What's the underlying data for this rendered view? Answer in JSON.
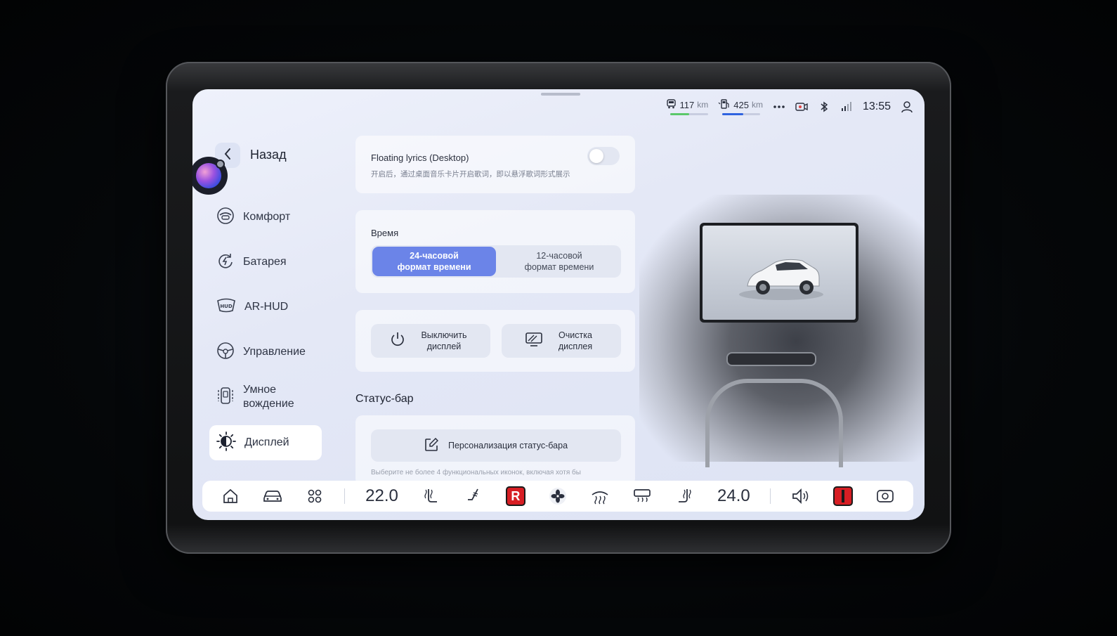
{
  "status_bar": {
    "range1_value": "117",
    "range1_unit": "km",
    "range1_level": 0.5,
    "range2_value": "425",
    "range2_unit": "km",
    "range2_level": 0.55,
    "time": "13:55",
    "colors": {
      "range1": "#5bc86a",
      "range2": "#2f63e0"
    }
  },
  "nav": {
    "back_label": "Назад",
    "items": [
      {
        "label": "Комфорт",
        "icon": "steering-comfort-icon"
      },
      {
        "label": "Батарея",
        "icon": "battery-cycle-icon"
      },
      {
        "label": "AR-HUD",
        "icon": "hud-icon"
      },
      {
        "label": "Управление",
        "icon": "steering-wheel-icon"
      },
      {
        "label": "Умное вождение",
        "icon": "smart-driving-icon"
      },
      {
        "label": "Дисплей",
        "icon": "brightness-icon",
        "active": true
      }
    ]
  },
  "settings": {
    "floating_lyrics": {
      "title": "Floating lyrics (Desktop)",
      "subtitle": "开启后，通过桌面音乐卡片开启歌词，即以悬浮歌词形式展示",
      "enabled": false
    },
    "time": {
      "title": "Время",
      "option_24": "24-часовой формат времени",
      "option_12": "12-часовой формат времени",
      "selected": "24"
    },
    "actions": {
      "turn_off_display": "Выключить дисплей",
      "clean_display": "Очистка дисплея"
    },
    "status_bar_section": {
      "title": "Статус-бар",
      "personalize_button": "Персонализация статус-бара",
      "hint": "Выберите не более 4 функциональных иконок, включая хотя бы"
    }
  },
  "dock": {
    "temp_left": "22.0",
    "temp_right": "24.0",
    "colors": {
      "accent_red": "#d71e24"
    }
  }
}
